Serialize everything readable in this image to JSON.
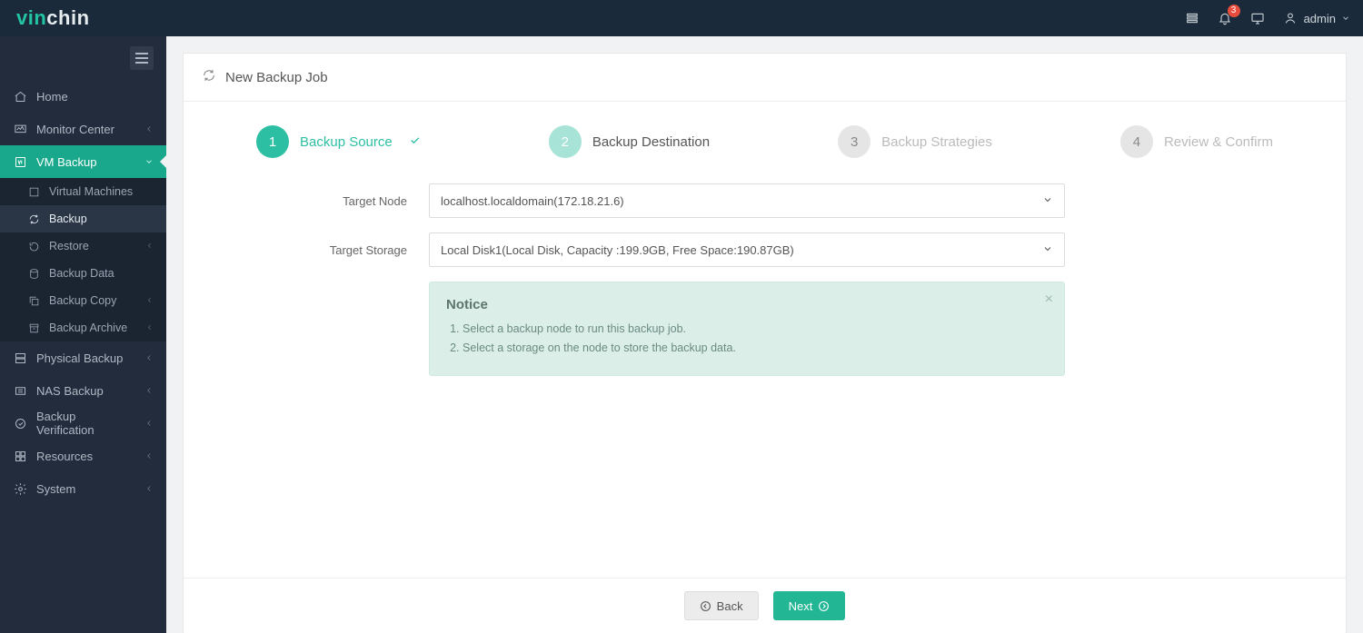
{
  "brand": {
    "part1": "vin",
    "part2": "chin"
  },
  "topbar": {
    "notif_count": "3",
    "user": "admin"
  },
  "sidebar": {
    "toggle": "menu",
    "items": [
      {
        "label": "Home"
      },
      {
        "label": "Monitor Center"
      },
      {
        "label": "VM Backup"
      },
      {
        "label": "Physical Backup"
      },
      {
        "label": "NAS Backup"
      },
      {
        "label": "Backup Verification"
      },
      {
        "label": "Resources"
      },
      {
        "label": "System"
      }
    ],
    "vm_sub": [
      {
        "label": "Virtual Machines"
      },
      {
        "label": "Backup"
      },
      {
        "label": "Restore"
      },
      {
        "label": "Backup Data"
      },
      {
        "label": "Backup Copy"
      },
      {
        "label": "Backup Archive"
      }
    ]
  },
  "page": {
    "title": "New Backup Job"
  },
  "steps": {
    "s1": {
      "num": "1",
      "label": "Backup Source"
    },
    "s2": {
      "num": "2",
      "label": "Backup Destination"
    },
    "s3": {
      "num": "3",
      "label": "Backup Strategies"
    },
    "s4": {
      "num": "4",
      "label": "Review & Confirm"
    }
  },
  "form": {
    "target_node_label": "Target Node",
    "target_node_value": "localhost.localdomain(172.18.21.6)",
    "target_storage_label": "Target Storage",
    "target_storage_value": "Local Disk1(Local Disk, Capacity :199.9GB, Free Space:190.87GB)"
  },
  "notice": {
    "title": "Notice",
    "items": {
      "0": "Select a backup node to run this backup job.",
      "1": "Select a storage on the node to store the backup data."
    }
  },
  "buttons": {
    "back": "Back",
    "next": "Next"
  }
}
